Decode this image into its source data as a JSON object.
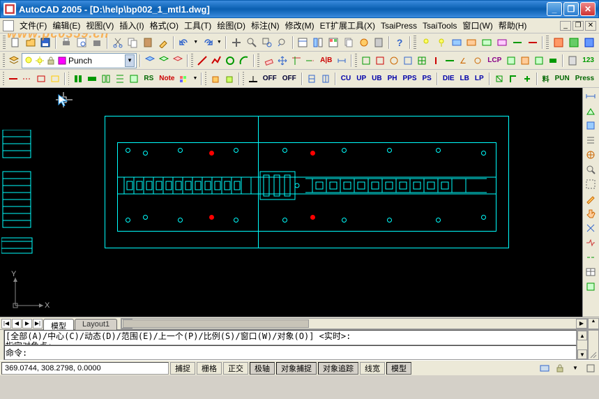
{
  "window": {
    "title": "AutoCAD 2005 - [D:\\help\\bp002_1_mtl1.dwg]"
  },
  "menu": [
    "文件(F)",
    "编辑(E)",
    "视图(V)",
    "插入(I)",
    "格式(O)",
    "工具(T)",
    "绘图(D)",
    "标注(N)",
    "修改(M)",
    "ET扩展工具(X)",
    "TsaiPress",
    "TsaiTools",
    "窗口(W)",
    "帮助(H)"
  ],
  "watermark": "www.pc0359.cn",
  "layer": {
    "current": "Punch"
  },
  "text_tools_row3": [
    "OFF",
    "OFF",
    "CU",
    "UP",
    "UB",
    "PH",
    "PPS",
    "PS",
    "DIE",
    "LB",
    "LP",
    "料",
    "PUN",
    "Press"
  ],
  "layout": {
    "tabs": [
      "模型",
      "Layout1"
    ],
    "active": 0
  },
  "cmd": {
    "history": "[全部(A)/中心(C)/动态(D)/范围(E)/上一个(P)/比例(S)/窗口(W)/对象(O)] <实时>:\n指定对角点:",
    "prompt": "命令:"
  },
  "status": {
    "coords": "369.0744, 308.2798, 0.0000",
    "buttons": [
      "捕捉",
      "栅格",
      "正交",
      "极轴",
      "对象捕捉",
      "对象追踪",
      "线宽",
      "模型"
    ],
    "active": [
      false,
      false,
      false,
      true,
      true,
      true,
      false,
      true
    ]
  },
  "icons": {
    "new": "new",
    "open": "open",
    "save": "save",
    "print": "print",
    "cut": "cut",
    "copy": "copy",
    "paste": "paste",
    "undo": "undo",
    "redo": "redo",
    "zoom": "zoom",
    "pan": "pan",
    "props": "props"
  },
  "ucs": {
    "x_label": "X",
    "y_label": "Y"
  },
  "toolbar2_labels": {
    "ab": "A|B",
    "num": "123"
  },
  "toolbar3_labels": {
    "rs": "RS",
    "note": "Note"
  }
}
